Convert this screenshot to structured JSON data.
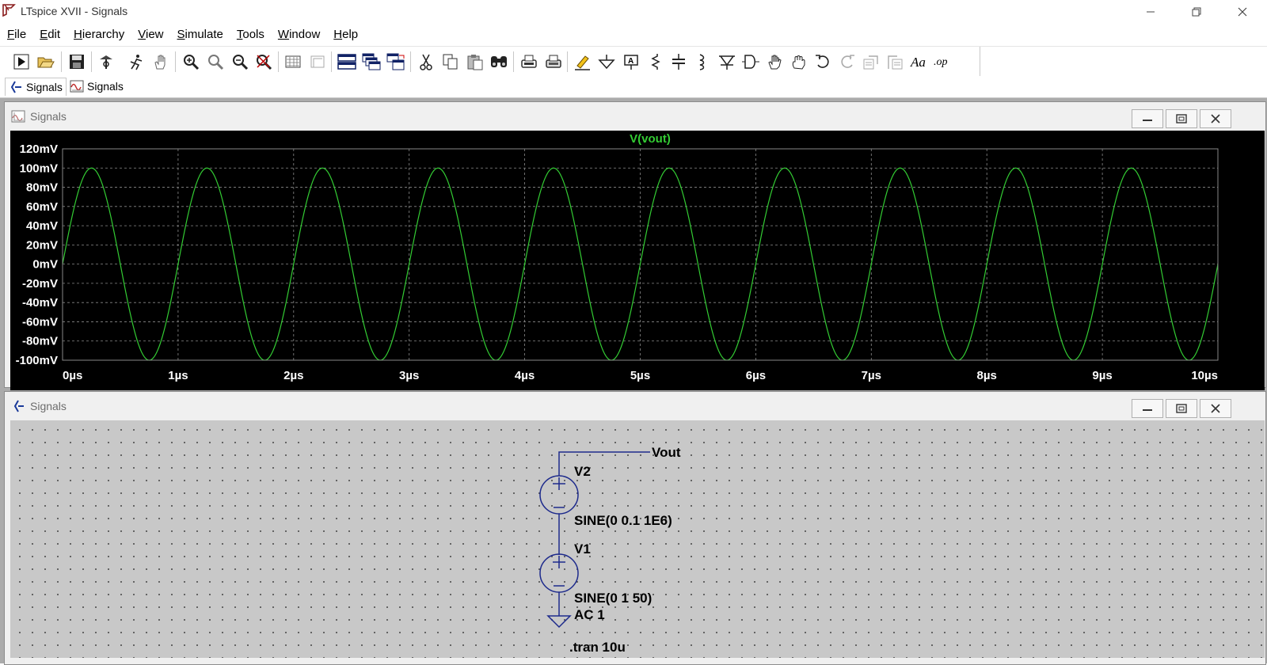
{
  "app": {
    "title": "LTspice XVII - Signals",
    "window_controls": {
      "minimize": "—",
      "restore": "❐",
      "close": "✕"
    }
  },
  "menu": [
    {
      "label": "File",
      "accel": "F",
      "rest": "ile"
    },
    {
      "label": "Edit",
      "accel": "E",
      "rest": "dit"
    },
    {
      "label": "Hierarchy",
      "accel": "H",
      "rest": "ierarchy"
    },
    {
      "label": "View",
      "accel": "V",
      "rest": "iew"
    },
    {
      "label": "Simulate",
      "accel": "S",
      "rest": "imulate"
    },
    {
      "label": "Tools",
      "accel": "T",
      "rest": "ools"
    },
    {
      "label": "Window",
      "accel": "W",
      "rest": "indow"
    },
    {
      "label": "Help",
      "accel": "H",
      "rest": "elp"
    }
  ],
  "toolbar_icons": [
    "run-icon",
    "open-icon",
    "save-icon",
    "control-panel-icon",
    "halt-icon",
    "pan-hand-icon",
    "zoom-in-icon",
    "zoom-area-icon",
    "zoom-out-icon",
    "zoom-cancel-icon",
    "autorange-icon",
    "mark-unused-icon",
    "tile-horizontal-icon",
    "cascade-icon",
    "tile-vertical-icon",
    "cut-icon",
    "copy-icon",
    "paste-icon",
    "find-icon",
    "print-preview-icon",
    "print-icon",
    "draw-wire-icon",
    "ground-icon",
    "label-net-icon",
    "resistor-icon",
    "capacitor-icon",
    "inductor-icon",
    "diode-icon",
    "component-icon",
    "move-icon",
    "drag-icon",
    "undo-icon",
    "redo-icon",
    "rotate-icon",
    "mirror-icon",
    "text-icon",
    "spice-directive-icon"
  ],
  "tabs": [
    {
      "label": "Signals",
      "icon": "schematic-icon",
      "active": true
    },
    {
      "label": "Signals",
      "icon": "waveform-icon",
      "active": false
    }
  ],
  "waveform_window": {
    "title": "Signals",
    "trace_label": "V(vout)",
    "trace_color": "#33cc33",
    "chart_data": {
      "type": "line",
      "title": "V(vout)",
      "x_unit": "µs",
      "y_unit": "mV",
      "xlim": [
        0,
        10
      ],
      "ylim": [
        -100,
        120
      ],
      "x_ticks": [
        "0µs",
        "1µs",
        "2µs",
        "3µs",
        "4µs",
        "5µs",
        "6µs",
        "7µs",
        "8µs",
        "9µs",
        "10µs"
      ],
      "y_ticks": [
        "120mV",
        "100mV",
        "80mV",
        "60mV",
        "40mV",
        "20mV",
        "0mV",
        "-20mV",
        "-40mV",
        "-60mV",
        "-80mV",
        "-100mV"
      ],
      "grid": true,
      "series": [
        {
          "name": "V(vout)",
          "amplitude": 100,
          "frequency_mhz": 1,
          "offset": 0
        }
      ]
    }
  },
  "schematic_window": {
    "title": "Signals",
    "net_label": "Vout",
    "v2": {
      "name": "V2",
      "value": "SINE(0 0.1 1E6)"
    },
    "v1": {
      "name": "V1",
      "value": "SINE(0 1 50)",
      "ac": "AC 1"
    },
    "directive": ".tran 10u"
  },
  "subwindow_controls": {
    "minimize": "minimize",
    "maximize": "maximize",
    "close": "close"
  }
}
